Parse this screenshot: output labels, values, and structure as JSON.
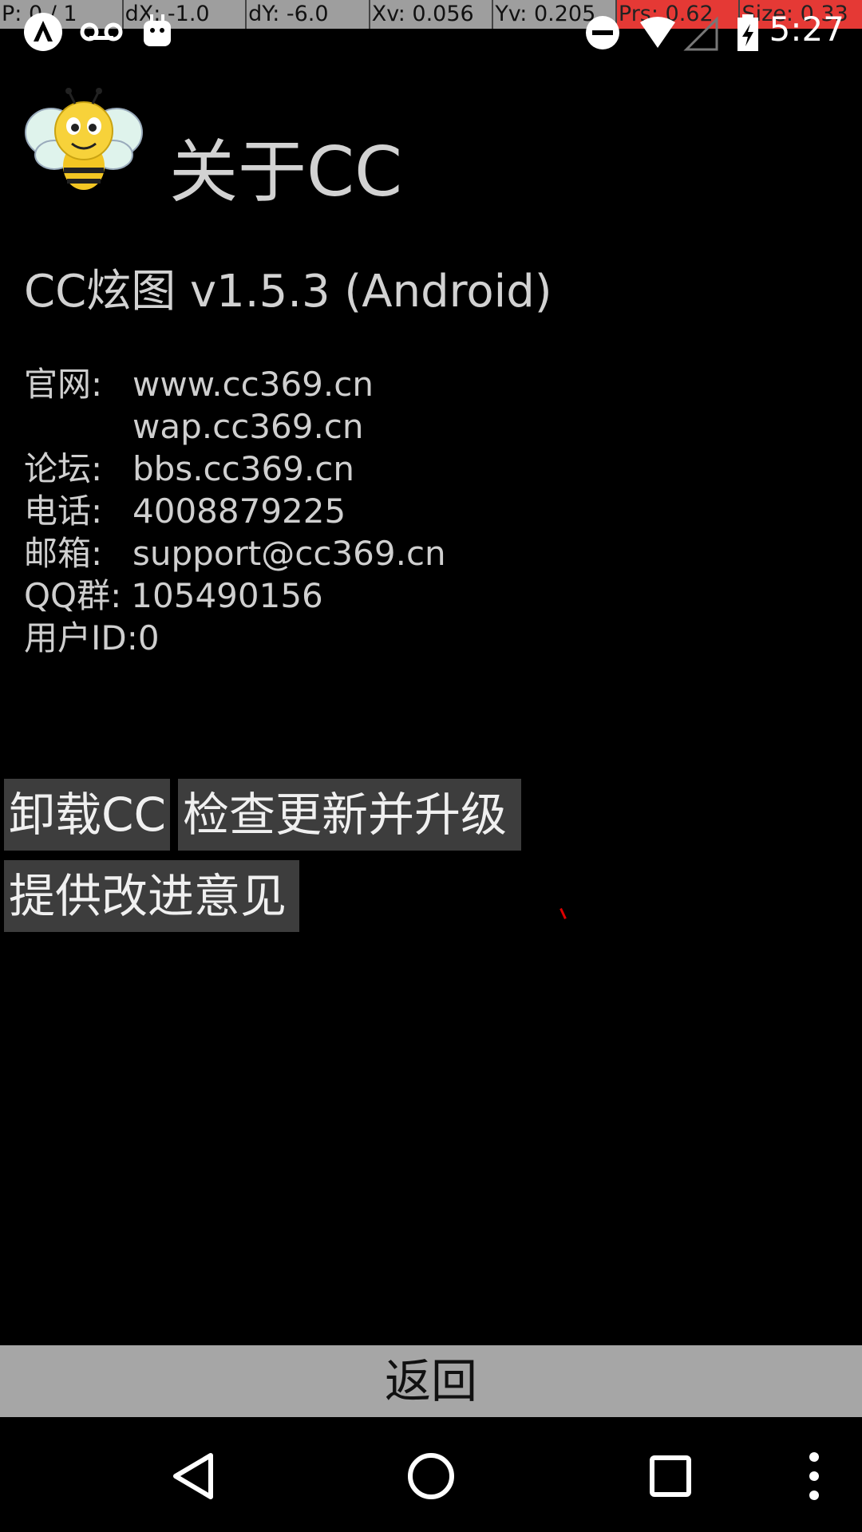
{
  "debug": {
    "p": "P: 0 / 1",
    "dx": "dX: -1.0",
    "dy": "dY: -6.0",
    "xv": "Xv: 0.056",
    "yv": "Yv: 0.205",
    "prs": "Prs: 0.62",
    "size": "Size: 0.33"
  },
  "status": {
    "time": "5:27",
    "icons": [
      "app-notification-icon",
      "voicemail-icon",
      "android-icon",
      "do-not-disturb-icon",
      "wifi-icon",
      "no-signal-icon",
      "battery-charging-icon"
    ]
  },
  "header": {
    "title": "关于CC",
    "logo": "bee-logo"
  },
  "version": "CC炫图 v1.5.3 (Android)",
  "info": {
    "website_label": "官网:",
    "website_value": "www.cc369.cn",
    "wap_value": "wap.cc369.cn",
    "forum_label": "论坛:",
    "forum_value": "bbs.cc369.cn",
    "phone_label": "电话:",
    "phone_value": "4008879225",
    "email_label": "邮箱:",
    "email_value": "support@cc369.cn",
    "qq_label": "QQ群:",
    "qq_value": "105490156",
    "userid": "用户ID:0"
  },
  "buttons": {
    "uninstall": "卸载CC",
    "update": "检查更新并升级",
    "feedback": "提供改进意见",
    "back": "返回"
  },
  "nav": {
    "icons": [
      "back-icon",
      "home-icon",
      "recents-icon",
      "overflow-menu-icon"
    ]
  },
  "colors": {
    "background": "#000000",
    "button": "#3d3d3d",
    "back_bar": "#a6a6a6",
    "debug_highlight": "#e53935"
  }
}
